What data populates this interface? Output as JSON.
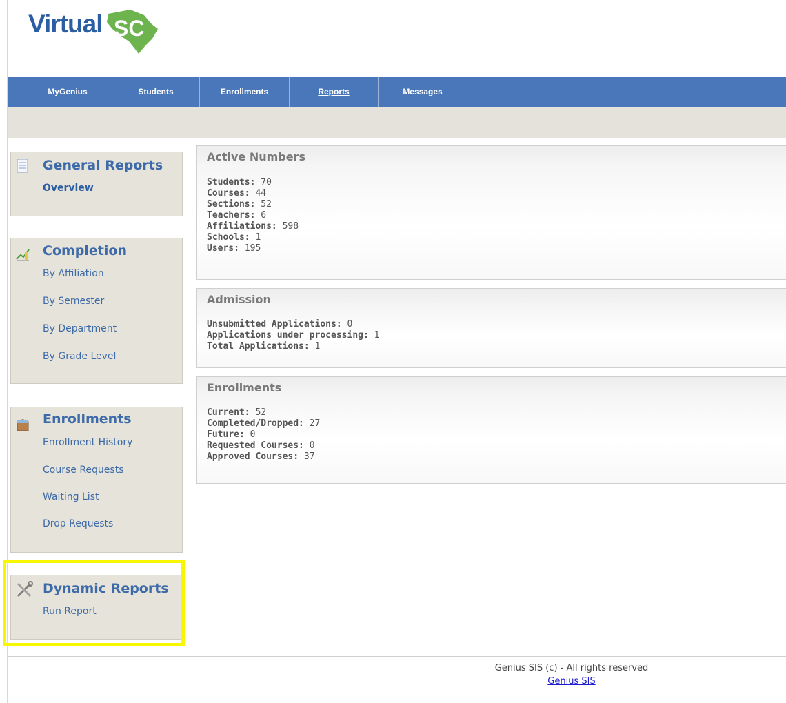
{
  "logo": {
    "text": "Virtual",
    "icon": "south-carolina-state-icon",
    "colors": {
      "text": "#2b5ea3",
      "shape": "#6db34e"
    }
  },
  "nav": {
    "items": [
      {
        "label": "MyGenius",
        "active": false
      },
      {
        "label": "Students",
        "active": false
      },
      {
        "label": "Enrollments",
        "active": false
      },
      {
        "label": "Reports",
        "active": true
      },
      {
        "label": "Messages",
        "active": false
      }
    ],
    "color": "#4a77b9"
  },
  "sidebar": {
    "general": {
      "title": "General Reports",
      "icon": "document-icon",
      "links": [
        "Overview"
      ]
    },
    "completion": {
      "title": "Completion",
      "icon": "chart-icon",
      "links": [
        "By Affiliation",
        "By Semester",
        "By Department",
        "By Grade Level"
      ]
    },
    "enrollments": {
      "title": "Enrollments",
      "icon": "bag-icon",
      "links": [
        "Enrollment History",
        "Course Requests",
        "Waiting List",
        "Drop Requests"
      ]
    },
    "dynamic": {
      "title": "Dynamic Reports",
      "icon": "tools-icon",
      "links": [
        "Run Report"
      ]
    }
  },
  "panels": {
    "active": {
      "title": "Active Numbers",
      "rows": [
        {
          "key": "Students:",
          "value": "70"
        },
        {
          "key": "Courses:",
          "value": "44"
        },
        {
          "key": "Sections:",
          "value": "52"
        },
        {
          "key": "Teachers:",
          "value": "6"
        },
        {
          "key": "Affiliations:",
          "value": "598"
        },
        {
          "key": "Schools:",
          "value": "1"
        },
        {
          "key": "Users:",
          "value": "195"
        }
      ]
    },
    "admission": {
      "title": "Admission",
      "rows": [
        {
          "key": "Unsubmitted Applications:",
          "value": "0"
        },
        {
          "key": "Applications under processing:",
          "value": "1"
        },
        {
          "key": "Total Applications:",
          "value": "1"
        }
      ]
    },
    "enrollments": {
      "title": "Enrollments",
      "rows": [
        {
          "key": "Current:",
          "value": "52"
        },
        {
          "key": "Completed/Dropped:",
          "value": "27"
        },
        {
          "key": "Future:",
          "value": "0"
        },
        {
          "key": "Requested Courses:",
          "value": "0"
        },
        {
          "key": "Approved Courses:",
          "value": "37"
        }
      ]
    }
  },
  "footer": {
    "text": "Genius SIS (c) - All rights reserved",
    "link": "Genius SIS"
  },
  "highlight_color": "#f6f700"
}
